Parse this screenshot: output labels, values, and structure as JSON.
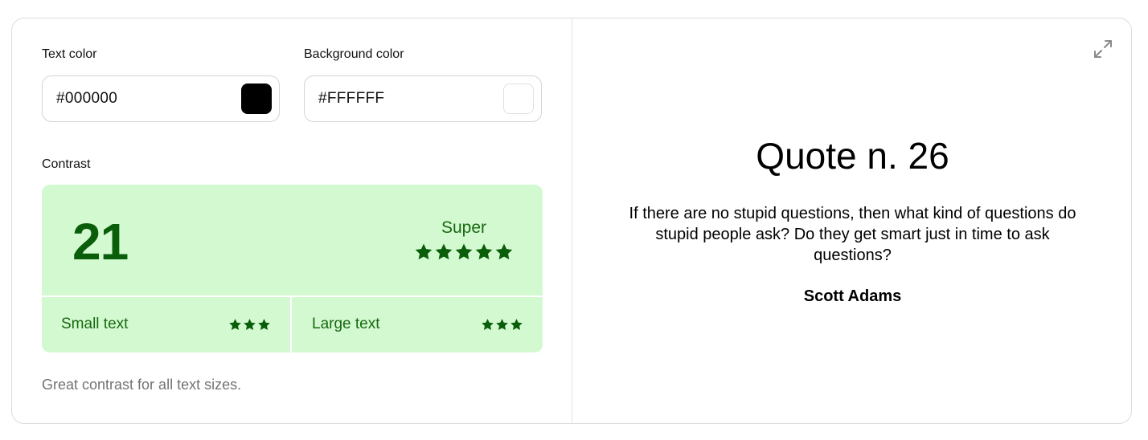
{
  "text_color": {
    "label": "Text color",
    "value": "#000000",
    "swatch": "#000000"
  },
  "background_color": {
    "label": "Background color",
    "value": "#FFFFFF",
    "swatch": "#FFFFFF"
  },
  "contrast": {
    "label": "Contrast",
    "ratio": "21",
    "rating": "Super",
    "rating_stars": 5,
    "small_text": {
      "label": "Small text",
      "stars": 3
    },
    "large_text": {
      "label": "Large text",
      "stars": 3
    },
    "note": "Great contrast for all text sizes.",
    "colors": {
      "box_bg": "#d3f9d1",
      "text": "#0a5e0a"
    }
  },
  "preview": {
    "expand_icon": "expand-icon",
    "title": "Quote n. 26",
    "quote": "If there are no stupid questions, then what kind of questions do stupid people ask? Do they get smart just in time to ask questions?",
    "author": "Scott Adams"
  }
}
